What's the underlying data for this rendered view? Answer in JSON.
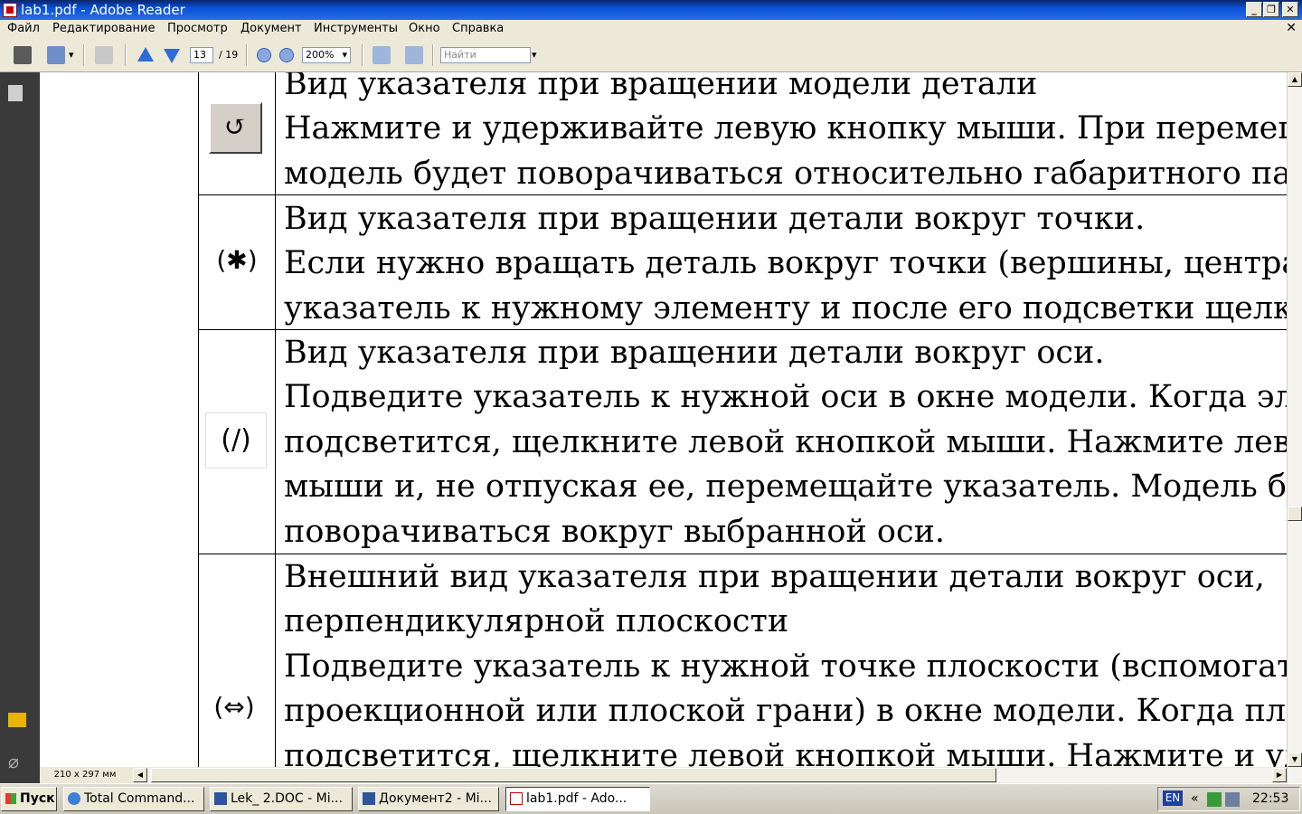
{
  "window": {
    "title": "lab1.pdf - Adobe Reader"
  },
  "menu": [
    "Файл",
    "Редактирование",
    "Просмотр",
    "Документ",
    "Инструменты",
    "Окно",
    "Справка"
  ],
  "toolbar": {
    "page_current": "13",
    "page_total": "/ 19",
    "zoom": "200%",
    "search_placeholder": "Найти"
  },
  "document": {
    "rows": [
      {
        "lines": [
          "Вид указателя при вращении модели детали",
          "Нажмите и удерживайте левую кнопку мыши. При перемещени",
          "модель будет поворачиваться относительно габаритного пар"
        ]
      },
      {
        "lines": [
          "Вид указателя при вращении детали вокруг точки.",
          "Если нужно вращать деталь вокруг точки (вершины, центра)",
          "указатель к нужному элементу и после его подсветки щелкни"
        ]
      },
      {
        "lines": [
          "Вид указателя при вращении детали вокруг оси.",
          "Подведите указатель к нужной оси в окне модели. Когда эле",
          "подсветится, щелкните левой кнопкой мыши. Нажмите левую",
          "мыши и, не отпуская ее, перемещайте указатель. Модель буд",
          "поворачиваться вокруг выбранной оси."
        ]
      },
      {
        "lines": [
          "Внешний вид указателя при вращении детали вокруг оси,",
          "перпендикулярной плоскости",
          "Подведите указатель к нужной точке плоскости (вспомогатель",
          "проекционной или плоской грани) в окне модели. Когда плос",
          "подсветится, щелкните левой кнопкой мыши. Нажмите и удер"
        ]
      }
    ]
  },
  "status": {
    "page_size": "210 x 297 мм"
  },
  "taskbar": {
    "start": "Пуск",
    "tasks": [
      "Total Command...",
      "Lek_ 2.DOC - Mi...",
      "Документ2 - Mi...",
      "lab1.pdf - Ado..."
    ],
    "lang": "EN",
    "chevron": "«",
    "clock": "22:53"
  }
}
